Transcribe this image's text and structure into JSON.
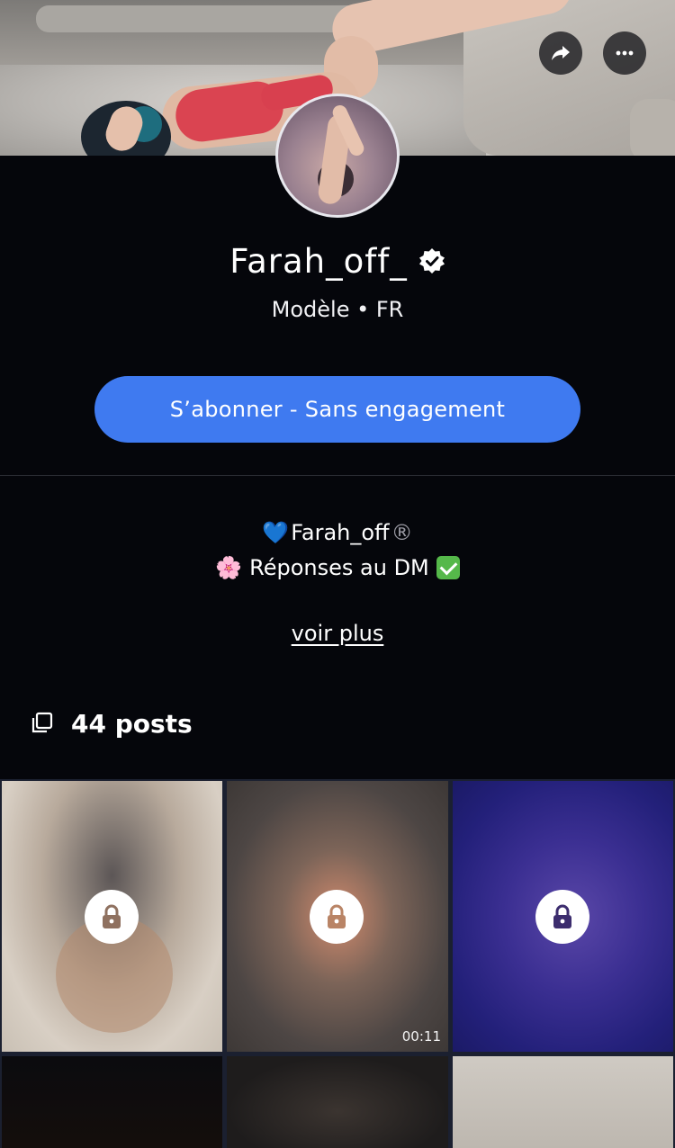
{
  "profile": {
    "name": "Farah_off_",
    "subtitle": "Modèle • FR",
    "verified": true
  },
  "actions": {
    "share_icon": "share-arrow-icon",
    "more_icon": "more-dots-icon",
    "subscribe_label": "S’abonner - Sans engagement"
  },
  "bio": {
    "line1": "Farah_off",
    "line1_heart": "💙",
    "line1_mark": "®",
    "line2": "Réponses au DM",
    "line2_flower": "🌸",
    "see_more": "voir plus"
  },
  "posts": {
    "count_label": "44 posts",
    "items": [
      {
        "locked": true,
        "lock_color": "#8f7160",
        "duration": ""
      },
      {
        "locked": true,
        "lock_color": "#b98466",
        "duration": "00:11"
      },
      {
        "locked": true,
        "lock_color": "#3c2d6e",
        "duration": ""
      },
      {
        "locked": false,
        "duration": ""
      },
      {
        "locked": false,
        "duration": ""
      },
      {
        "locked": false,
        "duration": ""
      }
    ]
  },
  "colors": {
    "background": "#05060b",
    "accent": "#3f7af0",
    "divider": "#2a2c33"
  }
}
